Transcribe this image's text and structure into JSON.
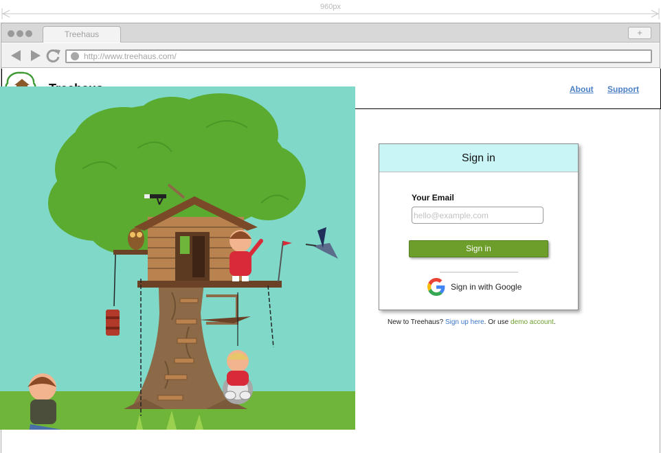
{
  "ruler": {
    "label": "960px"
  },
  "browser": {
    "tab_title": "Treehaus",
    "new_tab_symbol": "+",
    "url": "http://www.treehaus.com/",
    "icons": [
      "back-icon",
      "forward-icon",
      "reload-icon",
      "globe-icon"
    ]
  },
  "header": {
    "brand": "Treehaus",
    "nav": [
      {
        "label": "About"
      },
      {
        "label": "Support"
      }
    ]
  },
  "signin": {
    "title": "Sign in",
    "email_label": "Your Email",
    "email_placeholder": "hello@example.com",
    "email_value": "",
    "submit_label": "Sign in",
    "google_label": "Sign in with Google"
  },
  "footer_note": {
    "prefix": "New to Treehaus? ",
    "signup_link": "Sign up here",
    "middle": ". Or use ",
    "demo_link": "demo account",
    "suffix": "."
  },
  "colors": {
    "accent_green": "#6d9e2b",
    "card_header": "#c9f5f7",
    "link_blue": "#4a7fc4",
    "sky": "#7fd8c8",
    "grass": "#6fb53a"
  }
}
